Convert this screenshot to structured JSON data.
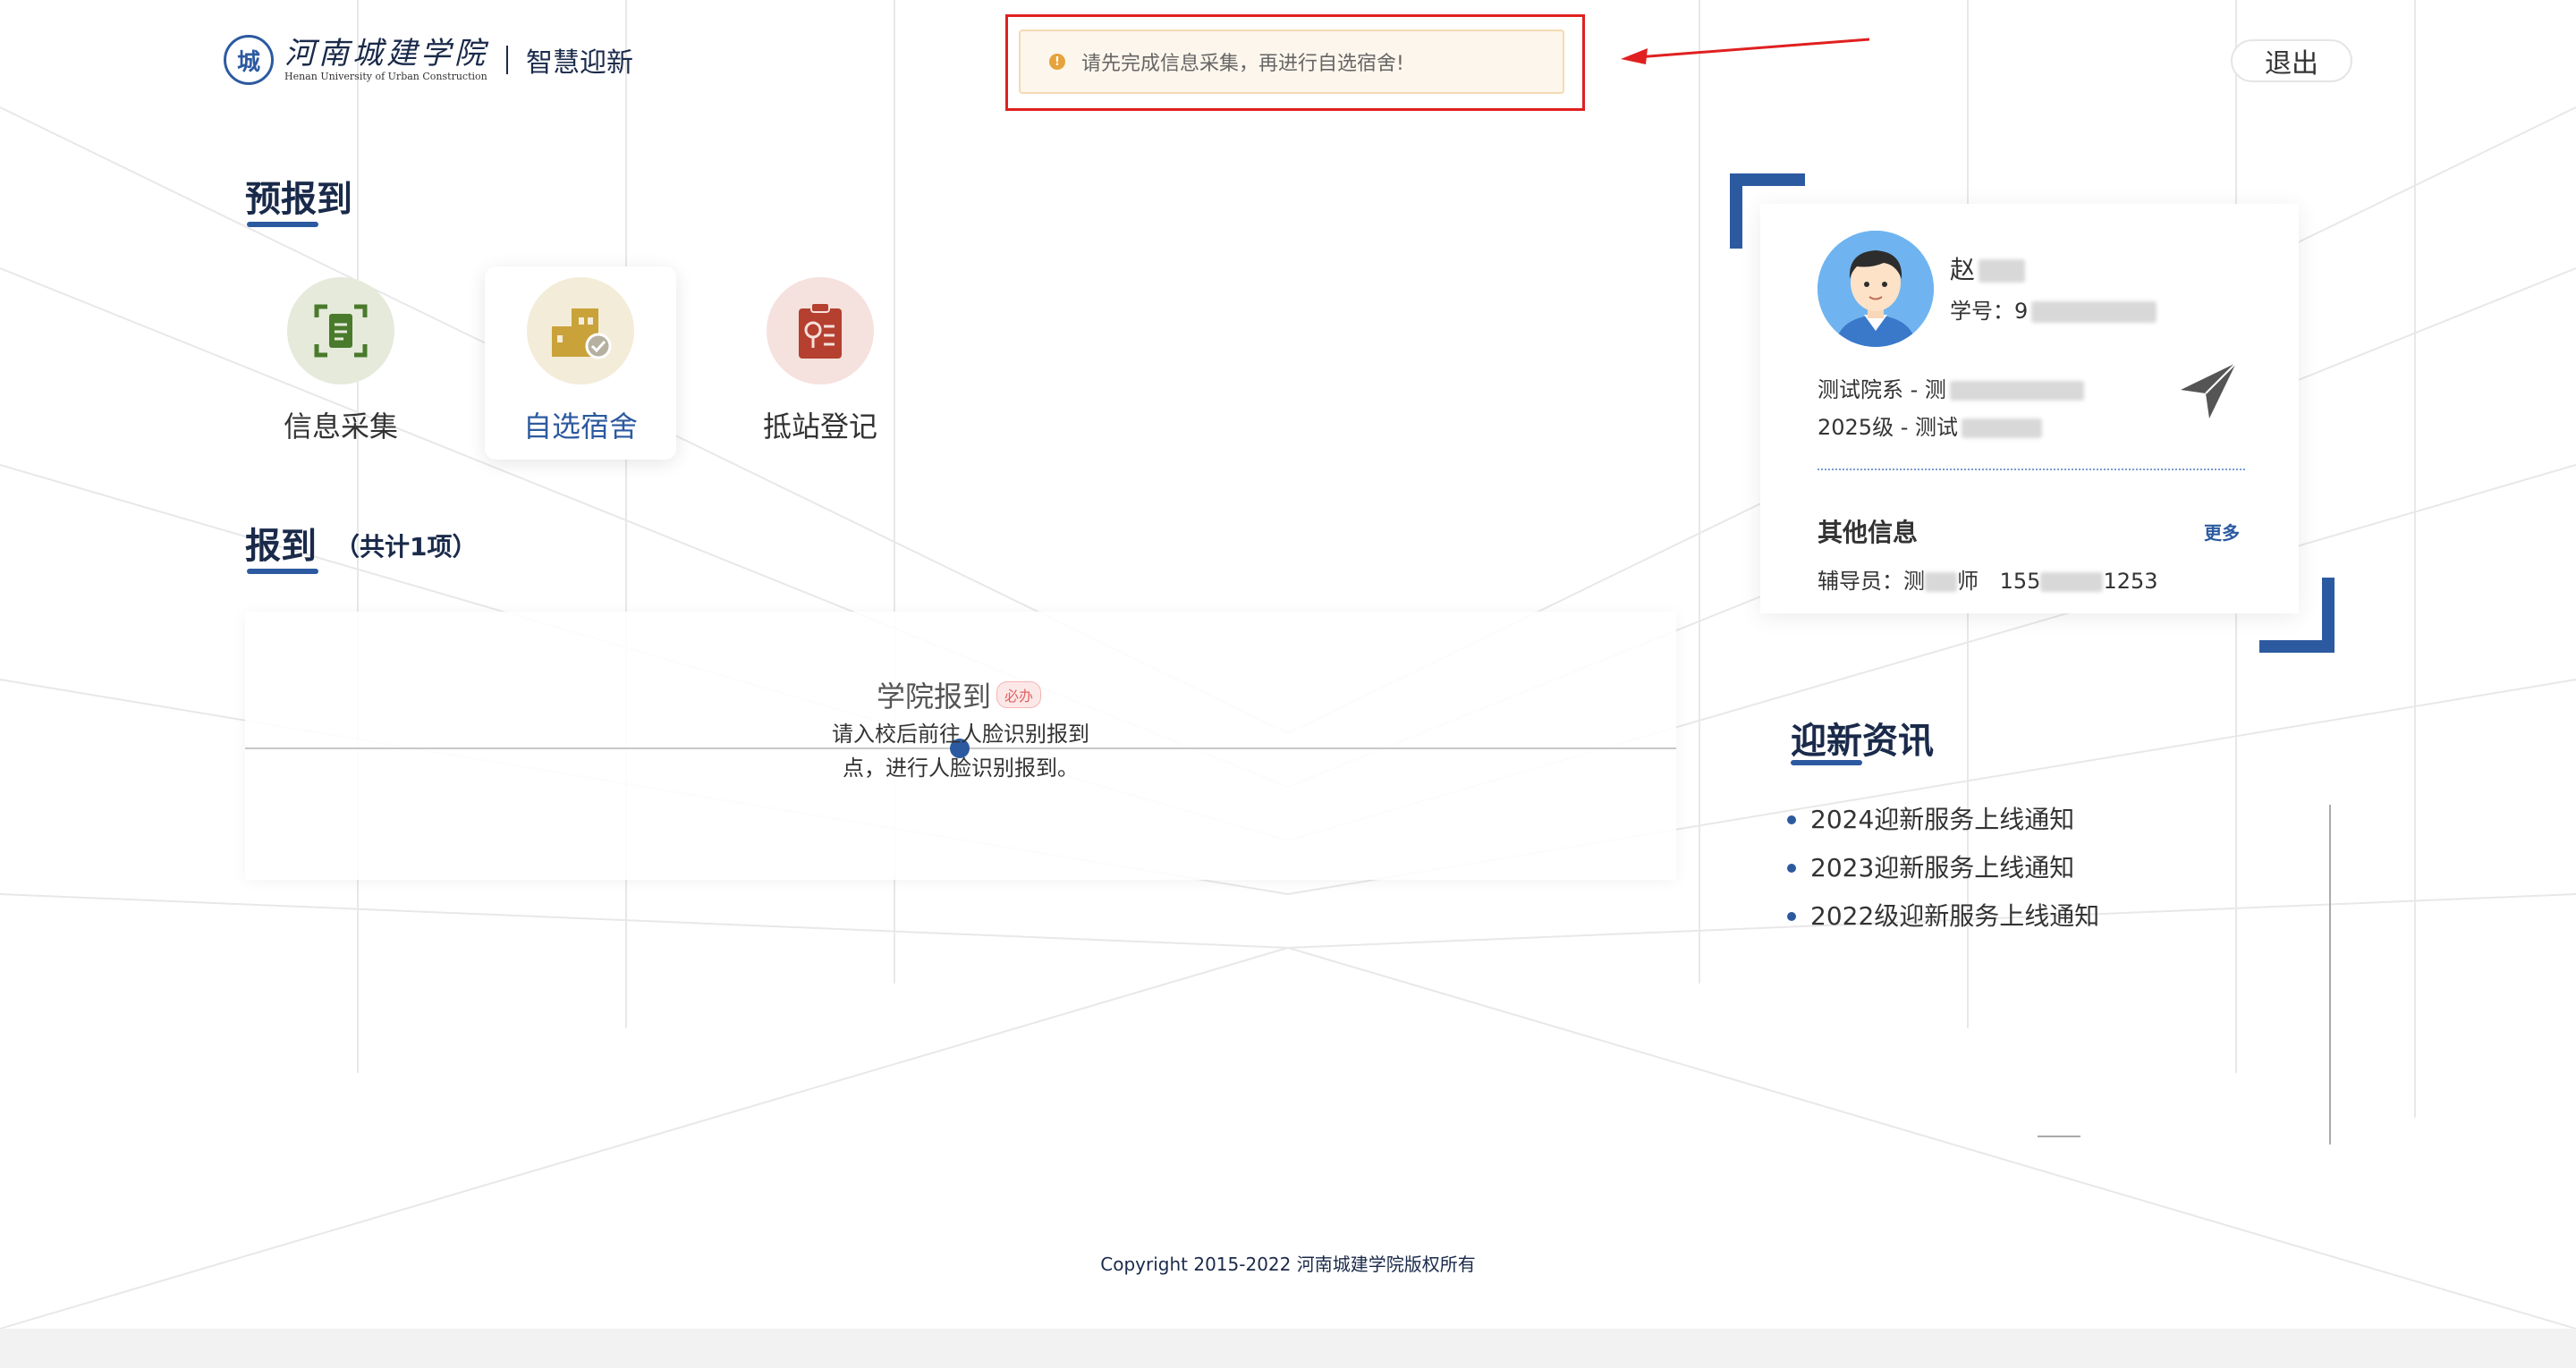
{
  "header": {
    "logo_cn": "河南城建学院",
    "logo_en": "Henan University of Urban Construction",
    "app_name": "智慧迎新",
    "logout_label": "退出"
  },
  "alert": {
    "icon": "warning-icon",
    "message": "请先完成信息采集，再进行自选宿舍!"
  },
  "pre_report": {
    "title": "预报到",
    "tiles": [
      {
        "label": "信息采集",
        "icon": "document-scan-icon",
        "color": "#4a7a2c"
      },
      {
        "label": "自选宿舍",
        "icon": "dormitory-icon",
        "color": "#c9a23a",
        "active": true
      },
      {
        "label": "抵站登记",
        "icon": "clipboard-icon",
        "color": "#b5402f"
      }
    ]
  },
  "report": {
    "title": "报到",
    "count": "（共计1项）",
    "items": [
      {
        "title": "学院报到",
        "badge": "必办",
        "description": "请入校后前往人脸识别报到点，进行人脸识别报到。"
      }
    ]
  },
  "profile": {
    "name_visible": "赵",
    "student_id_label": "学号：",
    "student_id_visible": "9",
    "dept_visible": "测试院系 - 测",
    "grade_visible": "2025级 - 测试",
    "other_title": "其他信息",
    "more_label": "更多",
    "counselor_label": "辅导员：",
    "counselor_name_start": "测",
    "counselor_name_end": "师",
    "phone_start": "155",
    "phone_end": "1253"
  },
  "news": {
    "title": "迎新资讯",
    "items": [
      "2024迎新服务上线通知",
      "2023迎新服务上线通知",
      "2022级迎新服务上线通知"
    ]
  },
  "footer": {
    "copyright": "Copyright 2015-2022 河南城建学院版权所有"
  },
  "colors": {
    "primary": "#2c5aa0",
    "title": "#1a2a4a",
    "alert_border": "#e02020",
    "warning": "#e6a23c"
  }
}
